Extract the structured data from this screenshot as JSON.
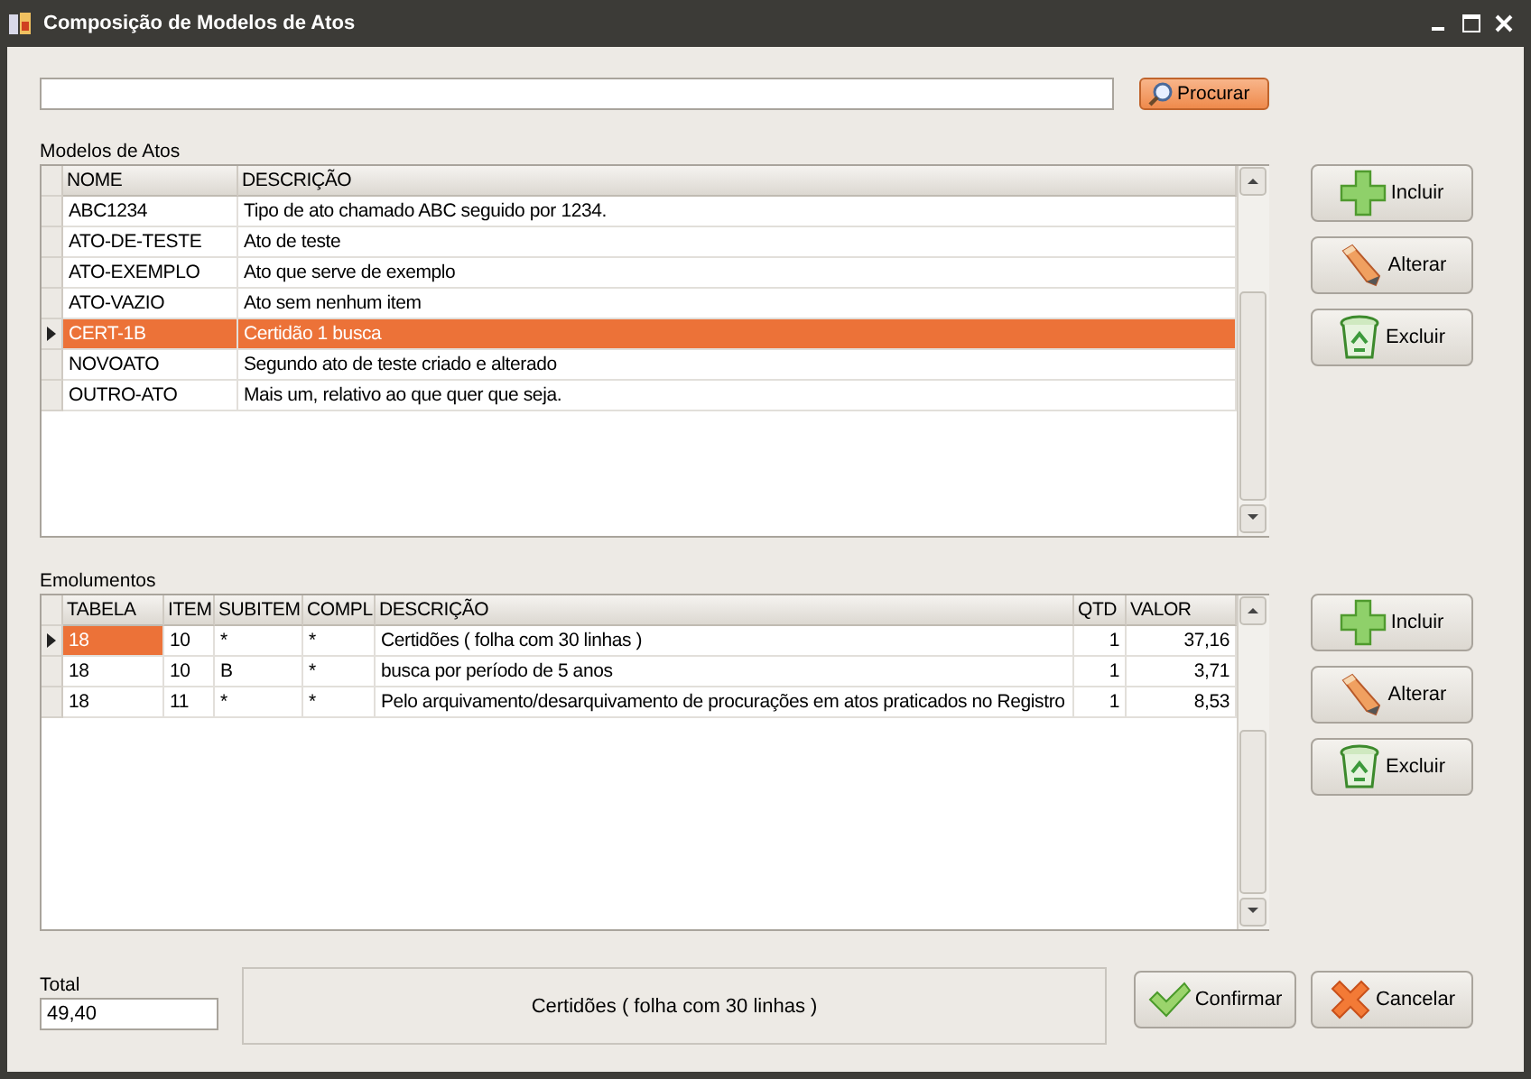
{
  "window": {
    "title": "Composição de Modelos de Atos"
  },
  "search_button": {
    "label": "Procurar"
  },
  "models": {
    "label": "Modelos de Atos",
    "columns": [
      "NOME",
      "DESCRIÇÃO"
    ],
    "rows": [
      {
        "cells": [
          "ABC1234",
          "Tipo de ato chamado ABC seguido por 1234."
        ],
        "selected": false
      },
      {
        "cells": [
          "ATO-DE-TESTE",
          "Ato de teste"
        ],
        "selected": false
      },
      {
        "cells": [
          "ATO-EXEMPLO",
          "Ato que serve de exemplo"
        ],
        "selected": false
      },
      {
        "cells": [
          "ATO-VAZIO",
          "Ato sem nenhum item"
        ],
        "selected": false
      },
      {
        "cells": [
          "CERT-1B",
          "Certidão 1 busca"
        ],
        "selected": true
      },
      {
        "cells": [
          "NOVOATO",
          "Segundo ato de teste criado e alterado"
        ],
        "selected": false
      },
      {
        "cells": [
          "OUTRO-ATO",
          "Mais um, relativo ao que quer que seja."
        ],
        "selected": false
      }
    ]
  },
  "model_buttons": [
    {
      "label": "Incluir",
      "kind": "add"
    },
    {
      "label": "Alterar",
      "kind": "edit"
    },
    {
      "label": "Excluir",
      "kind": "delete"
    }
  ],
  "fees": {
    "label": "Emolumentos",
    "columns": [
      "TABELA",
      "ITEM",
      "SUBITEM",
      "COMPL",
      "DESCRIÇÃO",
      "QTD",
      "VALOR"
    ],
    "rows": [
      {
        "cells": [
          "18",
          "10",
          "*",
          "*",
          "Certidões ( folha com 30 linhas )",
          "1",
          "37,16"
        ],
        "selected": true
      },
      {
        "cells": [
          "18",
          "10",
          "B",
          "*",
          "busca por período de 5 anos",
          "1",
          "3,71"
        ],
        "selected": false
      },
      {
        "cells": [
          "18",
          "11",
          "*",
          "*",
          "Pelo arquivamento/desarquivamento de procurações em atos praticados no Registro",
          "1",
          "8,53"
        ],
        "selected": false
      }
    ]
  },
  "fee_buttons": [
    {
      "label": "Incluir",
      "kind": "add"
    },
    {
      "label": "Alterar",
      "kind": "edit"
    },
    {
      "label": "Excluir",
      "kind": "delete"
    }
  ],
  "total": {
    "label": "Total",
    "value": "49,40"
  },
  "memo": "Certidões ( folha com 30 linhas )",
  "footer_buttons": [
    {
      "label": "Confirmar",
      "kind": "confirm"
    },
    {
      "label": "Cancelar",
      "kind": "cancel"
    }
  ]
}
